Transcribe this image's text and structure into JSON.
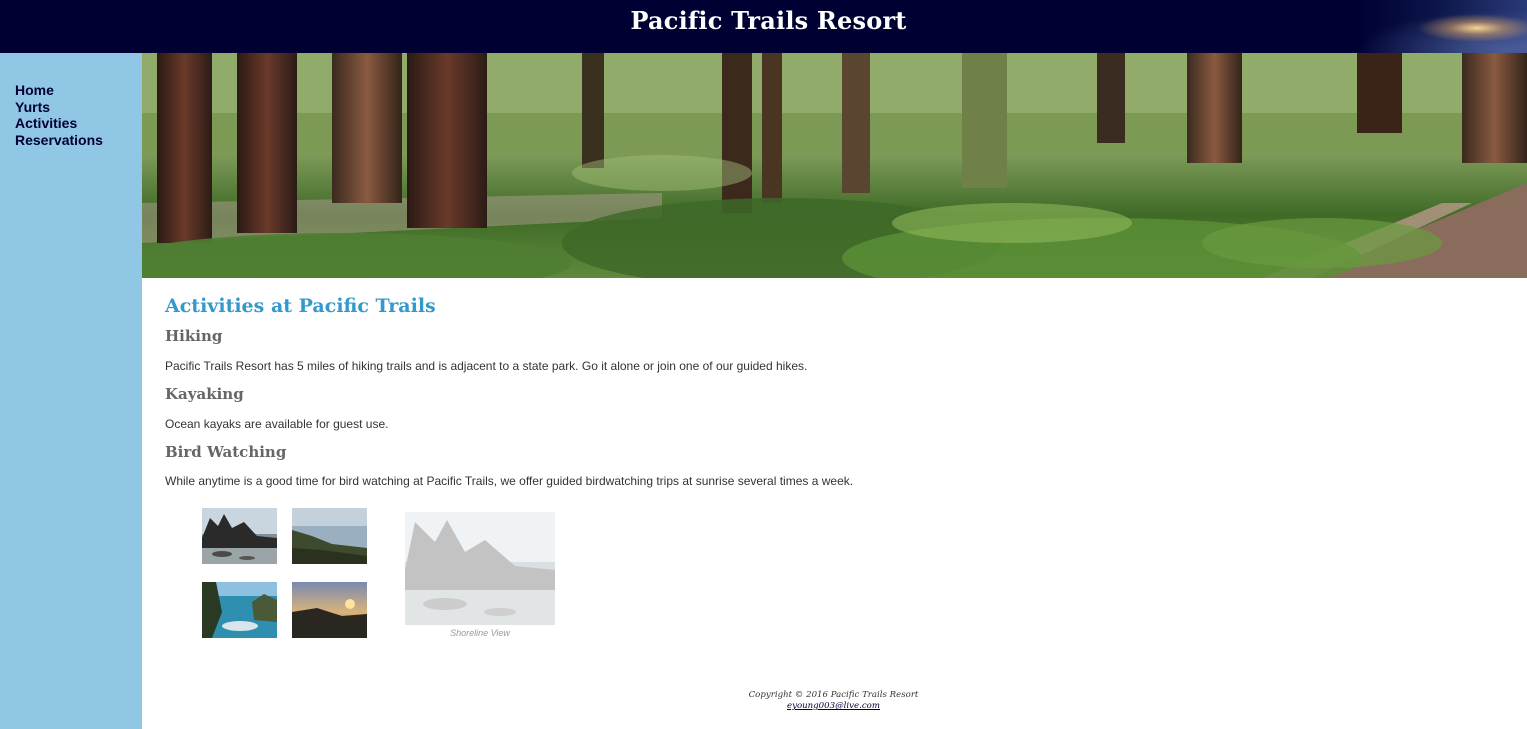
{
  "header": {
    "title": "Pacific Trails Resort"
  },
  "nav": {
    "items": [
      {
        "label": "Home"
      },
      {
        "label": "Yurts"
      },
      {
        "label": "Activities"
      },
      {
        "label": "Reservations"
      }
    ]
  },
  "main": {
    "title": "Activities at Pacific Trails",
    "sections": [
      {
        "heading": "Hiking",
        "text": "Pacific Trails Resort has 5 miles of hiking trails and is adjacent to a state park. Go it alone or join one of our guided hikes."
      },
      {
        "heading": "Kayaking",
        "text": "Ocean kayaks are available for guest use."
      },
      {
        "heading": "Bird Watching",
        "text": "While anytime is a good time for bird watching at Pacific Trails, we offer guided birdwatching trips at sunrise several times a week."
      }
    ]
  },
  "gallery": {
    "caption": "Shoreline View"
  },
  "footer": {
    "copyright": "Copyright © 2016 Pacific Trails Resort",
    "email": "eyoung003@live.com"
  },
  "colors": {
    "header_bg": "#000033",
    "sidebar_bg": "#8fc7e4",
    "title_blue": "#3399cc",
    "heading_gray": "#666666"
  }
}
